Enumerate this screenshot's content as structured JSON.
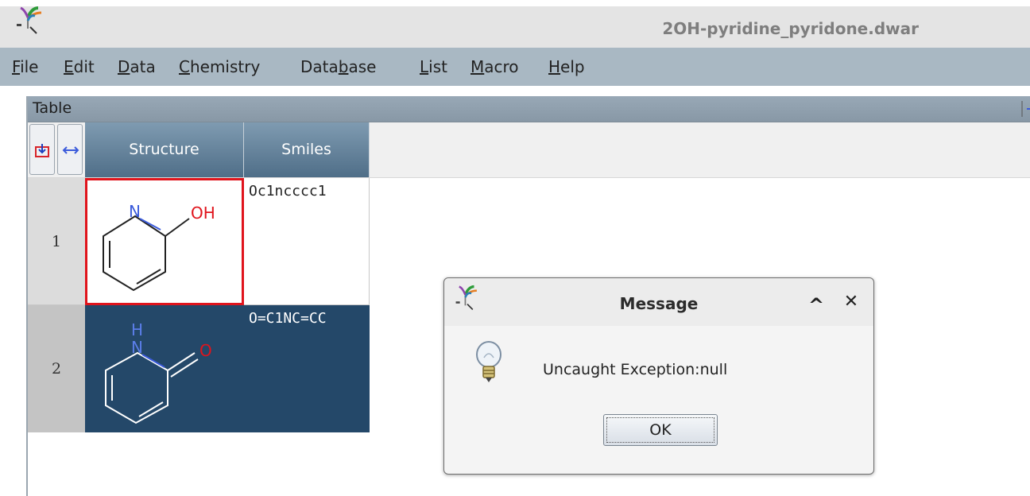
{
  "window": {
    "title": "2OH-pyridine_pyridone.dwar"
  },
  "menu": [
    {
      "label": "File",
      "mnemonic": "F",
      "rest": "ile"
    },
    {
      "label": "Edit",
      "mnemonic": "",
      "rest": "Edit"
    },
    {
      "label": "Data",
      "mnemonic": "D",
      "rest": "ata"
    },
    {
      "label": "Chemistry",
      "mnemonic": "C",
      "rest": "hemistry"
    },
    {
      "label": "Database",
      "mnemonic_pre": "Data",
      "mnemonic": "b",
      "rest": "ase"
    },
    {
      "label": "List",
      "mnemonic": "L",
      "rest": "ist"
    },
    {
      "label": "Macro",
      "mnemonic": "M",
      "rest": "acro"
    },
    {
      "label": "Help",
      "mnemonic": "H",
      "rest": "elp"
    }
  ],
  "table": {
    "panel_title": "Table",
    "columns": [
      "Structure",
      "Smiles"
    ],
    "rows": [
      {
        "num": "1",
        "smiles": "Oc1ncccc1",
        "selected": false,
        "atoms": {
          "n": "N",
          "oh": "OH"
        }
      },
      {
        "num": "2",
        "smiles": "O=C1NC=CC",
        "selected": true,
        "atoms": {
          "h": "H",
          "n": "N",
          "o": "O"
        }
      }
    ]
  },
  "dialog": {
    "title": "Message",
    "message": "Uncaught Exception:null",
    "ok_label": "OK",
    "minimize_glyph": "^",
    "close_glyph": "✕"
  },
  "colors": {
    "selected_row": "#244869",
    "highlight_border": "#e0141c",
    "nitrogen": "#3b5bdb",
    "oxygen": "#e0141c"
  }
}
